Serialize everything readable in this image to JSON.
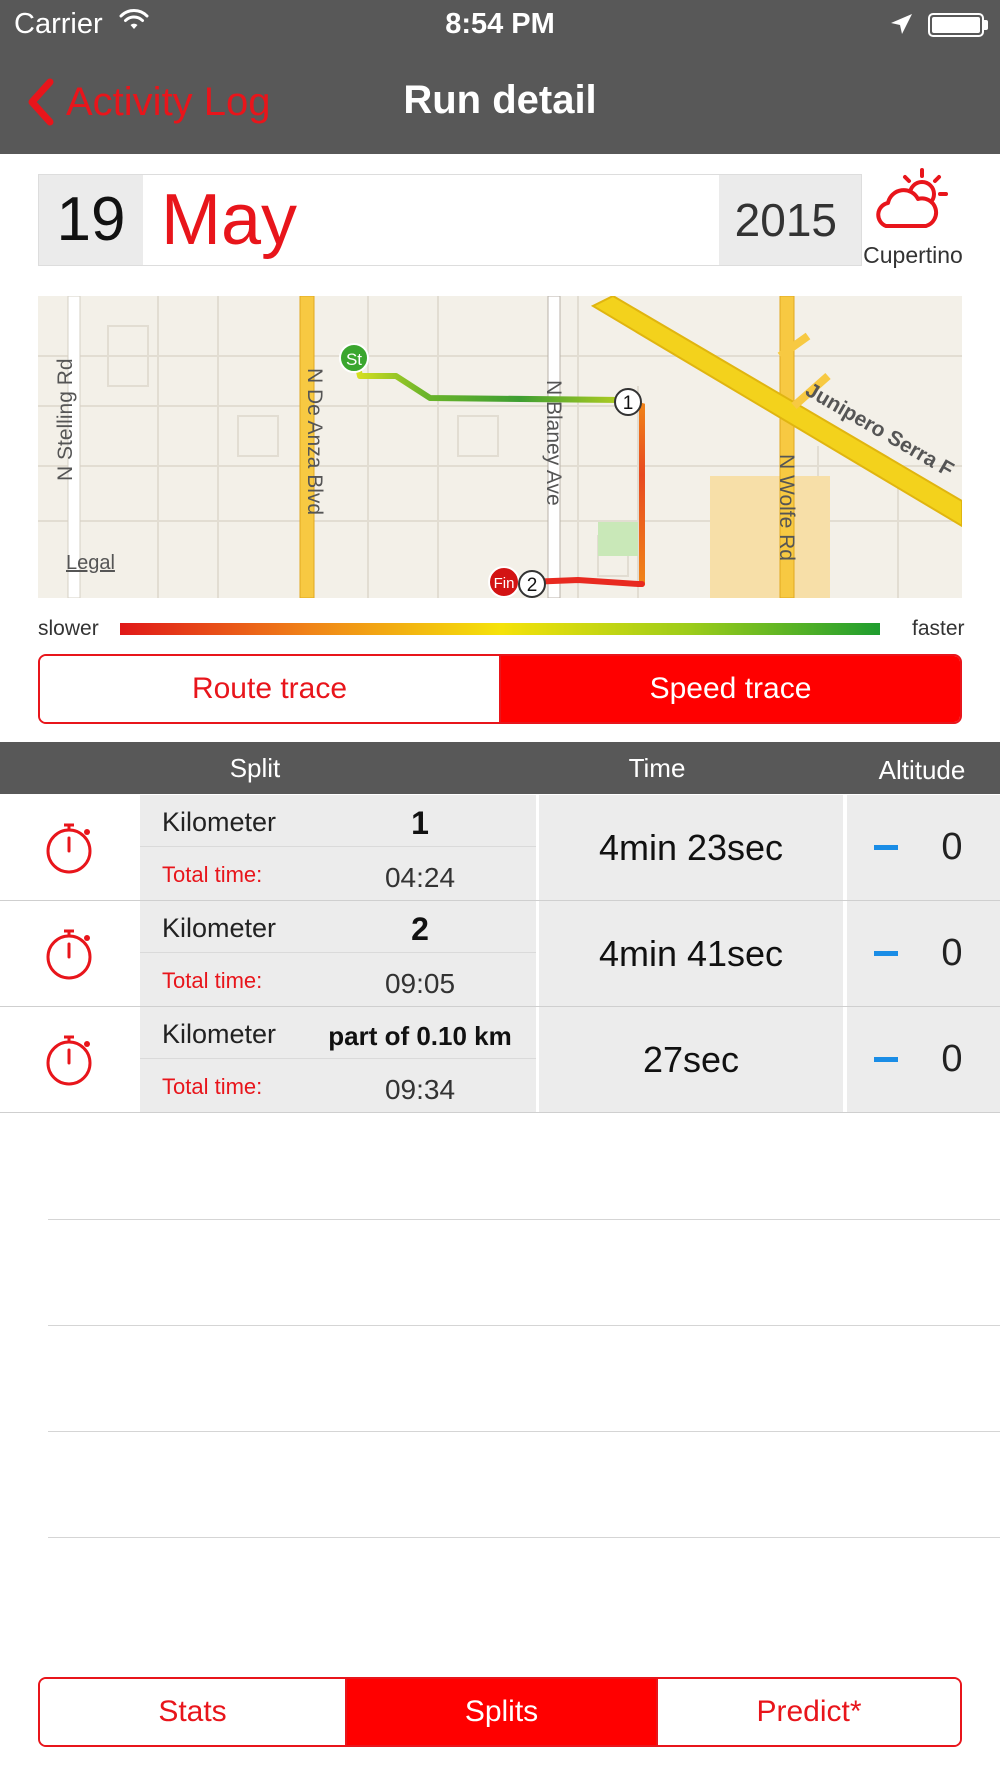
{
  "status_bar": {
    "carrier": "Carrier",
    "time": "8:54 PM"
  },
  "nav": {
    "back_label": "Activity Log",
    "title": "Run detail"
  },
  "date": {
    "day": "19",
    "month": "May",
    "year": "2015"
  },
  "weather": {
    "icon": "partly-cloudy-icon",
    "city": "Cupertino"
  },
  "map": {
    "streets": [
      "N Stelling Rd",
      "N De Anza Blvd",
      "N Blaney Ave",
      "N Wolfe Rd",
      "Junipero Serra F"
    ],
    "legal": "Legal",
    "markers": {
      "start": "St",
      "finish": "Fin",
      "km1": "1",
      "km2": "2"
    }
  },
  "speed_legend": {
    "slower": "slower",
    "faster": "faster"
  },
  "trace_toggle": {
    "options": [
      "Route trace",
      "Speed trace"
    ],
    "selected": "Speed trace"
  },
  "table": {
    "headers": {
      "split": "Split",
      "time": "Time",
      "altitude": "Altitude"
    },
    "rows": [
      {
        "label": "Kilometer",
        "value": "1",
        "total_label": "Total time:",
        "total": "04:24",
        "time": "4min 23sec",
        "altitude": "0"
      },
      {
        "label": "Kilometer",
        "value": "2",
        "total_label": "Total time:",
        "total": "09:05",
        "time": "4min 41sec",
        "altitude": "0"
      },
      {
        "label": "Kilometer",
        "value": "part of 0.10 km",
        "total_label": "Total time:",
        "total": "09:34",
        "time": "27sec",
        "altitude": "0"
      }
    ]
  },
  "bottom_tabs": {
    "options": [
      "Stats",
      "Splits",
      "Predict*"
    ],
    "selected": "Splits"
  },
  "colors": {
    "accent": "#ff0000",
    "bar": "#585858",
    "altitude_dash": "#1a8de6"
  }
}
